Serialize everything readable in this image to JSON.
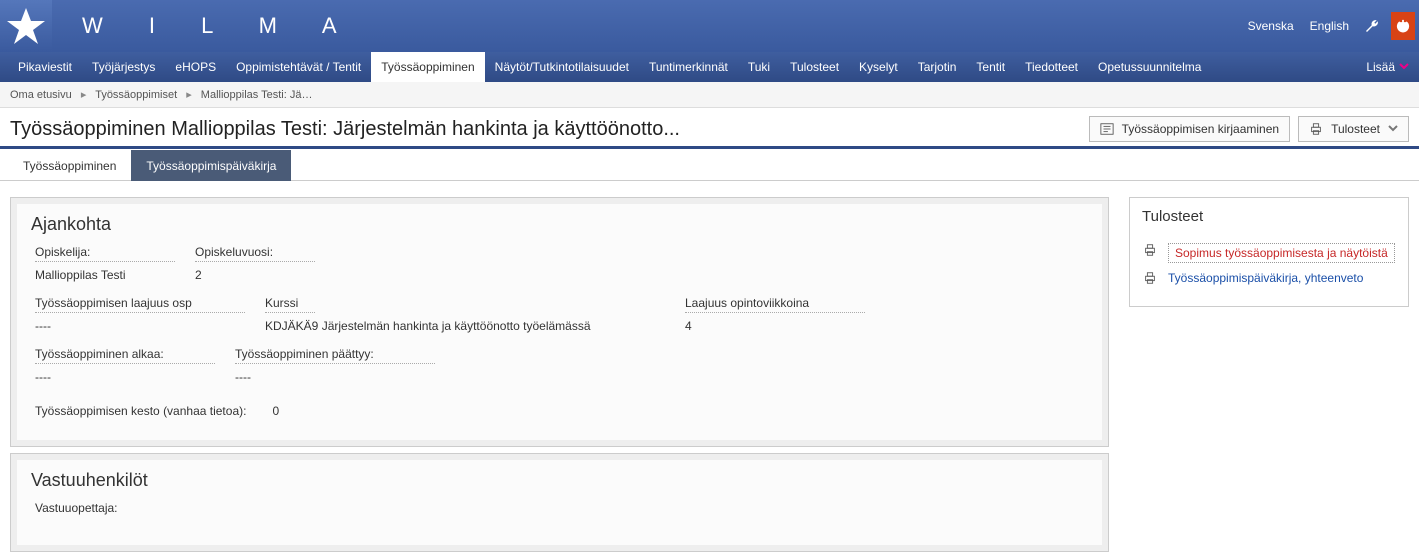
{
  "brand": "W I L M A",
  "languages": {
    "sv": "Svenska",
    "en": "English"
  },
  "nav": [
    {
      "label": "Pikaviestit"
    },
    {
      "label": "Työjärjestys"
    },
    {
      "label": "eHOPS"
    },
    {
      "label": "Oppimistehtävät / Tentit"
    },
    {
      "label": "Työssäoppiminen"
    },
    {
      "label": "Näytöt/Tutkintotilaisuudet"
    },
    {
      "label": "Tuntimerkinnät"
    },
    {
      "label": "Tuki"
    },
    {
      "label": "Tulosteet"
    },
    {
      "label": "Kyselyt"
    },
    {
      "label": "Tarjotin"
    },
    {
      "label": "Tentit"
    },
    {
      "label": "Tiedotteet"
    },
    {
      "label": "Opetussuunnitelma"
    }
  ],
  "nav_more": "Lisää",
  "nav_active_index": 4,
  "breadcrumbs": [
    "Oma etusivu",
    "Työssäoppimiset",
    "Mallioppilas Testi: Jä…"
  ],
  "page_title": "Työssäoppiminen Mallioppilas Testi: Järjestelmän hankinta ja käyttöönotto...",
  "head_buttons": {
    "kirjaaminen": "Työssäoppimisen kirjaaminen",
    "tulosteet": "Tulosteet"
  },
  "tabs": [
    {
      "label": "Työssäoppiminen"
    },
    {
      "label": "Työssäoppimispäiväkirja"
    }
  ],
  "tab_selected_index": 1,
  "sections": {
    "ajankohta": {
      "title": "Ajankohta",
      "opiskelija_label": "Opiskelija:",
      "opiskelija_value": "Mallioppilas Testi",
      "opiskeluvuosi_label": "Opiskeluvuosi:",
      "opiskeluvuosi_value": "2",
      "laajuus_osp_label": "Työssäoppimisen laajuus osp",
      "laajuus_osp_value": "----",
      "kurssi_label": "Kurssi",
      "kurssi_value": "KDJÄKÄ9 Järjestelmän hankinta ja käyttöönotto työelämässä",
      "laajuus_ov_label": "Laajuus opintoviikkoina",
      "laajuus_ov_value": "4",
      "alkaa_label": "Työssäoppiminen alkaa:",
      "alkaa_value": "----",
      "paattyy_label": "Työssäoppiminen päättyy:",
      "paattyy_value": "----",
      "kesto_label": "Työssäoppimisen kesto (vanhaa tietoa):",
      "kesto_value": "0"
    },
    "vastuu": {
      "title": "Vastuuhenkilöt",
      "vastuuopettaja_label": "Vastuuopettaja:"
    }
  },
  "side": {
    "title": "Tulosteet",
    "items": [
      {
        "label": "Sopimus työssäoppimisesta ja näytöistä",
        "red": true,
        "boxed": true
      },
      {
        "label": "Työssäoppimispäiväkirja, yhteenveto",
        "red": false,
        "boxed": false
      }
    ]
  }
}
